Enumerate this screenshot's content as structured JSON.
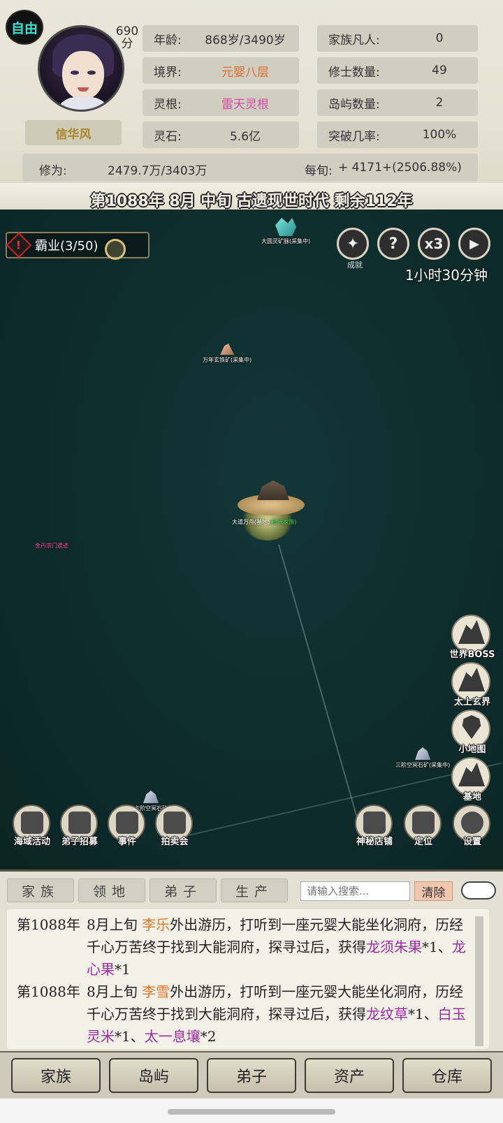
{
  "profile": {
    "status_badge": "自由",
    "score": "690",
    "score_unit": "分",
    "name": "信华风"
  },
  "stats": {
    "age_label": "年龄:",
    "age_value": "868岁/3490岁",
    "realm_label": "境界:",
    "realm_value": "元婴八层",
    "root_label": "灵根:",
    "root_value": "雷天灵根",
    "stone_label": "灵石:",
    "stone_value": "5.6亿",
    "family_label": "家族凡人:",
    "family_value": "0",
    "cultivators_label": "修士数量:",
    "cultivators_value": "49",
    "islands_label": "岛屿数量:",
    "islands_value": "2",
    "breakthrough_label": "突破几率:",
    "breakthrough_value": "100%",
    "cultivation_label": "修为:",
    "cultivation_value": "2479.7万/3403万",
    "per_tick_label": "每旬:",
    "per_tick_value": "+ 4171+(2506.88%)"
  },
  "date_line": "第1088年 8月 中旬  古遗现世时代 剩余112年",
  "map": {
    "quest_label": "霸业(3/50)",
    "achievement_caption": "成就",
    "help_symbol": "?",
    "speed_label": "x3",
    "timer": "1小时30分钟",
    "node_crystal": "大圆灵矿脉(采集中)",
    "node_ore": "万年玄铁矿(采集中)",
    "node_home_main": "大道万舟(基地)",
    "node_home_tag": "(雷氏家族)",
    "node_pink": "金丹宗门遗迹",
    "node_stone": "三阶空冥石矿(采集中)",
    "node_stone2": "六阶空冥石矿",
    "side_icons": [
      {
        "label": "世界BOSS"
      },
      {
        "label": "太上玄界"
      },
      {
        "label": "小地图"
      },
      {
        "label": "基地"
      }
    ],
    "bottom_left_icons": [
      {
        "label": "海域活动"
      },
      {
        "label": "弟子招募"
      },
      {
        "label": "事件"
      },
      {
        "label": "拍卖会"
      }
    ],
    "bottom_right_icons": [
      {
        "label": "神秘店铺"
      },
      {
        "label": "定位"
      },
      {
        "label": "设置"
      }
    ]
  },
  "log": {
    "tabs": [
      "家族",
      "领地",
      "弟子",
      "生产"
    ],
    "search_placeholder": "请输入搜索...",
    "clear_label": "清除",
    "entries": [
      {
        "date": "第1088年",
        "prefix": "8月上旬 ",
        "actor": "李乐",
        "text": "外出游历，打听到一座元婴大能坐化洞府，历经千心万苦终于找到大能洞府，探寻过后，获得",
        "item1": "龙须朱果",
        "q1": "*1、",
        "item2": "龙心果",
        "q2": "*1",
        "item3": "",
        "q3": ""
      },
      {
        "date": "第1088年",
        "prefix": "8月上旬 ",
        "actor": "李雪",
        "text": "外出游历，打听到一座元婴大能坐化洞府，历经千心万苦终于找到大能洞府，探寻过后，获得",
        "item1": "龙纹草",
        "q1": "*1、",
        "item2": "白玉灵米",
        "q2": "*1、",
        "item3": "太一息壤",
        "q3": "*2"
      }
    ]
  },
  "bottom_nav": [
    "家族",
    "岛屿",
    "弟子",
    "资产",
    "仓库"
  ]
}
